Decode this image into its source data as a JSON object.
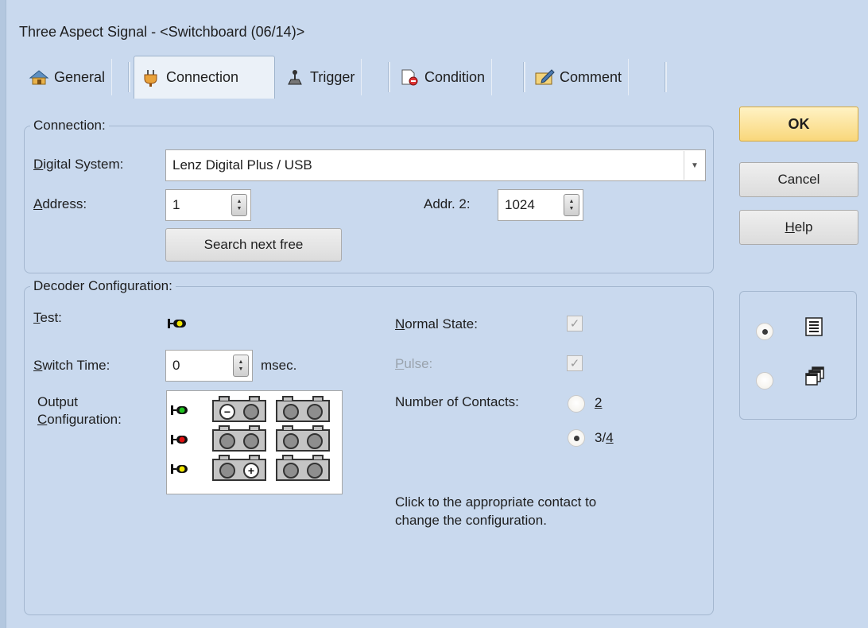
{
  "window": {
    "title": "Three Aspect Signal - <Switchboard (06/14)>"
  },
  "tabs": [
    {
      "label": "General",
      "icon": "general-icon",
      "active": false
    },
    {
      "label": "Connection",
      "icon": "plug-icon",
      "active": true
    },
    {
      "label": "Trigger",
      "icon": "trigger-icon",
      "active": false
    },
    {
      "label": "Condition",
      "icon": "condition-icon",
      "active": false
    },
    {
      "label": "Comment",
      "icon": "comment-icon",
      "active": false
    }
  ],
  "connection": {
    "group_label": "Connection:",
    "digital_system_label": "Digital System:",
    "digital_system_value": "Lenz Digital Plus / USB",
    "address_label": "Address:",
    "address_value": "1",
    "addr2_label": "Addr. 2:",
    "addr2_value": "1024",
    "search_button": "Search next free"
  },
  "decoder": {
    "group_label": "Decoder Configuration:",
    "test_label": "Test:",
    "switch_time_label": "Switch Time:",
    "switch_time_value": "0",
    "switch_time_unit": "msec.",
    "output_label_1": "Output",
    "output_label_2": "Configuration:",
    "normal_state_label": "Normal State:",
    "normal_state_checked": true,
    "pulse_label": "Pulse:",
    "pulse_checked": true,
    "contacts_label": "Number of Contacts:",
    "contacts_options": [
      "2",
      "3/4"
    ],
    "contacts_selected": "3/4",
    "hint_line1": "Click to the appropriate contact to",
    "hint_line2": "change the configuration.",
    "signal_colors": {
      "green": "#1fc21f",
      "red": "#e01010",
      "yellow": "#f2e600"
    }
  },
  "buttons": {
    "ok": "OK",
    "cancel": "Cancel",
    "help": "Help"
  },
  "view_mode": {
    "options": [
      "list-view-icon",
      "multi-window-icon"
    ],
    "selected": "list-view-icon"
  }
}
